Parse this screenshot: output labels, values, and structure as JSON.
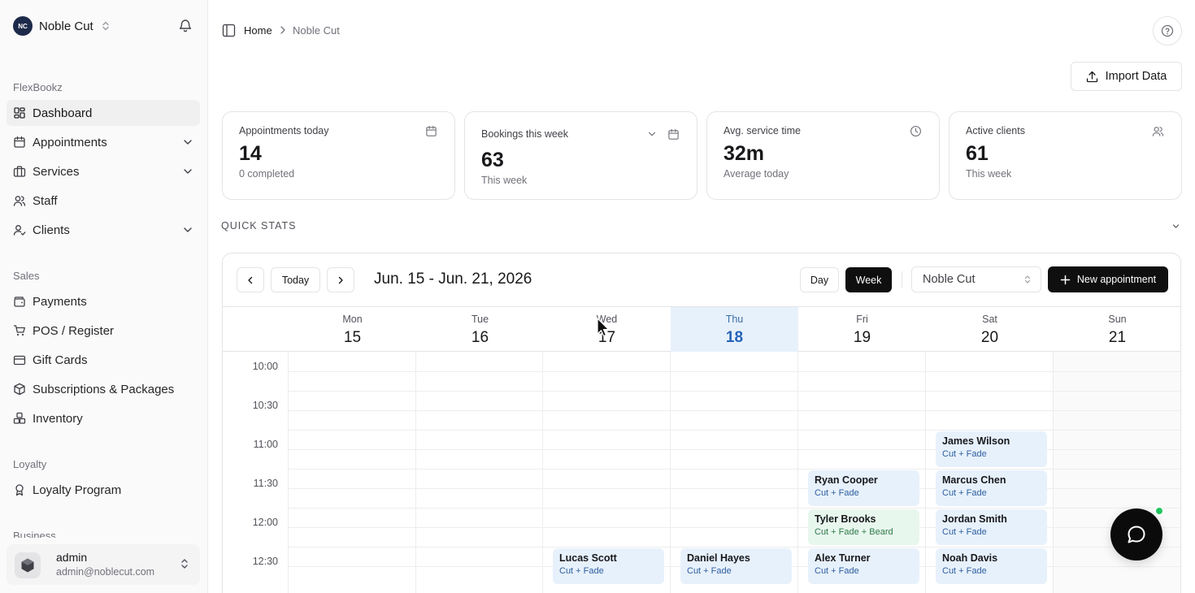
{
  "org": {
    "initials": "NC",
    "name": "Noble Cut"
  },
  "sidebar": {
    "sections": [
      {
        "label": "FlexBookz"
      },
      {
        "label": "Sales"
      },
      {
        "label": "Loyalty"
      },
      {
        "label": "Business"
      }
    ],
    "items": [
      {
        "label": "Dashboard",
        "icon": "dashboard-icon"
      },
      {
        "label": "Appointments",
        "icon": "calendar-icon"
      },
      {
        "label": "Services",
        "icon": "briefcase-icon"
      },
      {
        "label": "Staff",
        "icon": "users-icon"
      },
      {
        "label": "Clients",
        "icon": "user-check-icon"
      },
      {
        "label": "Payments",
        "icon": "wallet-icon"
      },
      {
        "label": "POS / Register",
        "icon": "cart-icon"
      },
      {
        "label": "Gift Cards",
        "icon": "gift-icon"
      },
      {
        "label": "Subscriptions & Packages",
        "icon": "package-icon"
      },
      {
        "label": "Inventory",
        "icon": "boxes-icon"
      },
      {
        "label": "Loyalty Program",
        "icon": "award-icon"
      }
    ]
  },
  "user": {
    "name": "admin",
    "email": "admin@noblecut.com"
  },
  "breadcrumb": {
    "home": "Home",
    "current": "Noble Cut"
  },
  "import_button": "Import Data",
  "stats": [
    {
      "label": "Appointments today",
      "value": "14",
      "sub": "0 completed",
      "icon": "calendar-icon"
    },
    {
      "label": "Bookings this week",
      "value": "63",
      "sub": "This week",
      "icon": "calendar-icon"
    },
    {
      "label": "Avg. service time",
      "value": "32m",
      "sub": "Average today",
      "icon": "clock-icon"
    },
    {
      "label": "Active clients",
      "value": "61",
      "sub": "This week",
      "icon": "users-icon"
    }
  ],
  "quick_stats_label": "QUICK STATS",
  "calendar": {
    "today_button": "Today",
    "range": "Jun. 15 - Jun. 21, 2026",
    "views": [
      "Day",
      "Week"
    ],
    "active_view": "Week",
    "location": "Noble Cut",
    "new_appointment": "New appointment",
    "days": [
      {
        "dow": "Mon",
        "num": "15"
      },
      {
        "dow": "Tue",
        "num": "16"
      },
      {
        "dow": "Wed",
        "num": "17"
      },
      {
        "dow": "Thu",
        "num": "18",
        "today": true
      },
      {
        "dow": "Fri",
        "num": "19"
      },
      {
        "dow": "Sat",
        "num": "20"
      },
      {
        "dow": "Sun",
        "num": "21"
      }
    ],
    "times": [
      "10:00",
      "10:30",
      "11:00",
      "11:30",
      "12:00",
      "12:30"
    ],
    "appointments": [
      {
        "day": "Sat",
        "start": "11:00",
        "name": "James Wilson",
        "service": "Cut + Fade",
        "color": "blue"
      },
      {
        "day": "Fri",
        "start": "11:30",
        "name": "Ryan Cooper",
        "service": "Cut + Fade",
        "color": "blue"
      },
      {
        "day": "Sat",
        "start": "11:30",
        "name": "Marcus Chen",
        "service": "Cut + Fade",
        "color": "blue"
      },
      {
        "day": "Fri",
        "start": "12:00",
        "name": "Tyler Brooks",
        "service": "Cut + Fade + Beard",
        "color": "green"
      },
      {
        "day": "Sat",
        "start": "12:00",
        "name": "Jordan Smith",
        "service": "Cut + Fade",
        "color": "blue"
      },
      {
        "day": "Wed",
        "start": "12:30",
        "name": "Lucas Scott",
        "service": "Cut + Fade",
        "color": "blue"
      },
      {
        "day": "Thu",
        "start": "12:30",
        "name": "Daniel Hayes",
        "service": "Cut + Fade",
        "color": "blue"
      },
      {
        "day": "Fri",
        "start": "12:30",
        "name": "Alex Turner",
        "service": "Cut + Fade",
        "color": "blue"
      },
      {
        "day": "Sat",
        "start": "12:30",
        "name": "Noah Davis",
        "service": "Cut + Fade",
        "color": "blue"
      }
    ]
  },
  "colors": {
    "accent": "#2563b8",
    "today_bg": "#e7f1fc",
    "appt_blue": "#e7f1fc",
    "appt_green": "#e8f7ee",
    "online": "#22c55e"
  }
}
